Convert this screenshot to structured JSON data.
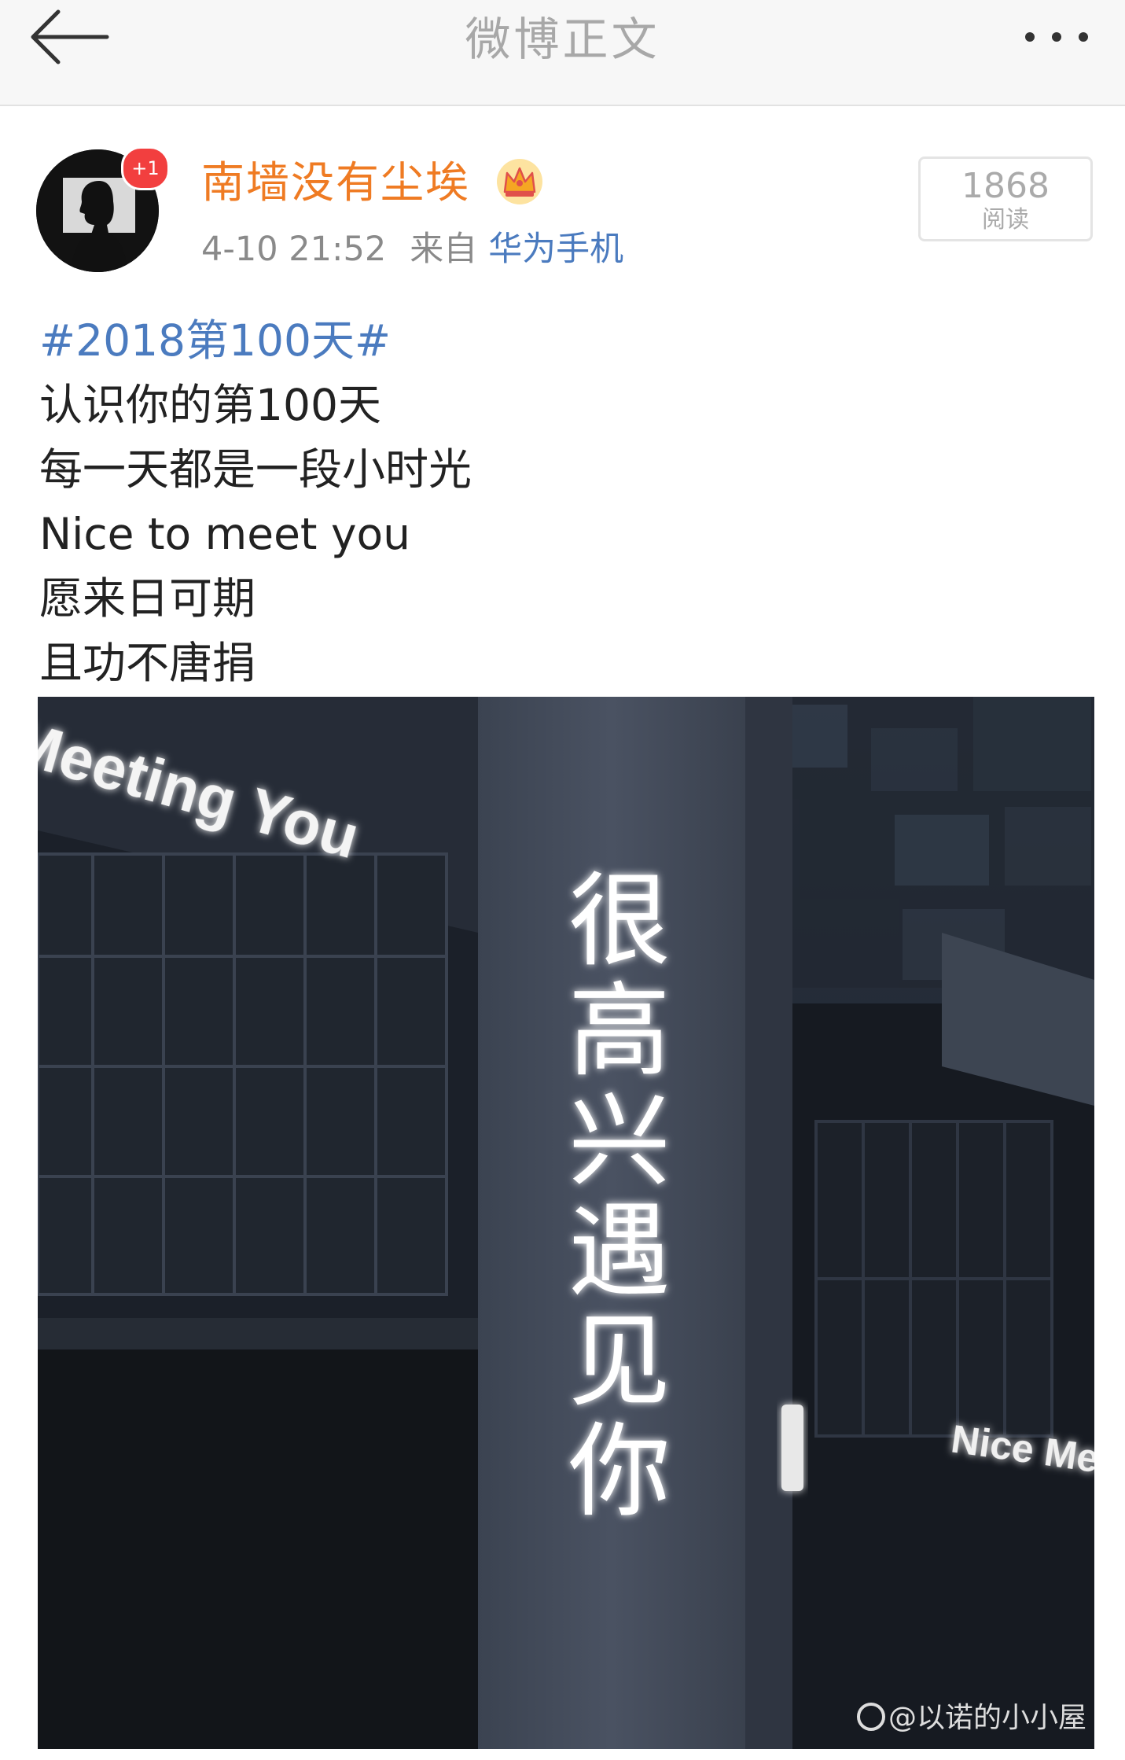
{
  "header": {
    "title": "微博正文",
    "back_icon": "arrow-left-icon",
    "more_icon": "more-dots-icon"
  },
  "author": {
    "name": "南墙没有尘埃",
    "badge": "+1",
    "vip_icon": "crown-icon",
    "time": "4-10 21:52",
    "source_prefix": "来自",
    "source": "华为手机",
    "name_color": "#ef7b23"
  },
  "stats": {
    "read_count": "1868",
    "read_label": "阅读"
  },
  "post": {
    "hashtag": "#2018第100天#",
    "lines": [
      "认识你的第100天",
      "每一天都是一段小时光",
      "Nice to meet you",
      "愿来日可期",
      "且功不唐捐"
    ],
    "link_color": "#4b7bbf"
  },
  "image": {
    "sign_top": "Meeting You",
    "sign_vertical": [
      "很",
      "高",
      "兴",
      "遇",
      "见",
      "你"
    ],
    "sign_right": "Nice Meetin",
    "watermark": "@以诺的小小屋"
  }
}
